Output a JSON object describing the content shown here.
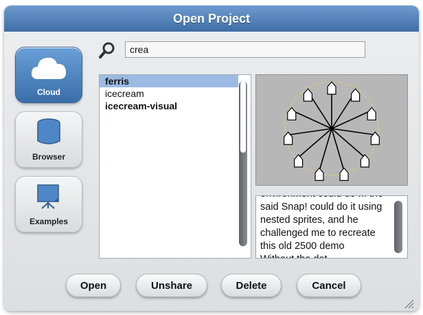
{
  "dialog": {
    "title": "Open Project"
  },
  "sources": [
    {
      "label": "Cloud",
      "icon": "cloud-icon",
      "active": true
    },
    {
      "label": "Browser",
      "icon": "database-icon",
      "active": false
    },
    {
      "label": "Examples",
      "icon": "projector-screen-icon",
      "active": false
    }
  ],
  "search": {
    "icon": "magnifier-icon",
    "value": "crea"
  },
  "projects": [
    {
      "name": "ferris",
      "selected": true,
      "bold": true
    },
    {
      "name": "icecream",
      "selected": false,
      "bold": false
    },
    {
      "name": "icecream-visual",
      "selected": false,
      "bold": true
    }
  ],
  "preview": {
    "icon": "ferris-wheel-thumbnail"
  },
  "notes": {
    "text": "environment could do ... the\nsaid Snap! could do it using\nnested sprites, and he\nchallenged me to recreate\nthis old 2500 demo\n          Without the dot..."
  },
  "buttons": {
    "open": "Open",
    "unshare": "Unshare",
    "delete": "Delete",
    "cancel": "Cancel"
  },
  "colors": {
    "accent": "#4a7fbf",
    "selection": "#9bbbe4"
  }
}
